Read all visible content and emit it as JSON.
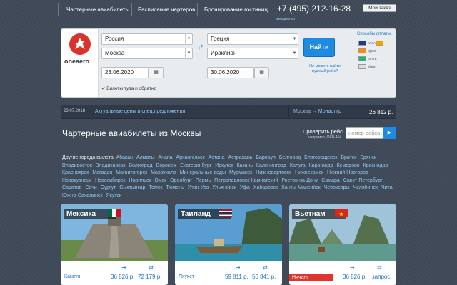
{
  "nav": {
    "links": [
      "Чартерные авиабилеты",
      "Расписание чартеров",
      "Бронирование гостиниц"
    ],
    "phone": "+7 (495) 212-16-28",
    "phone_sub": "менеджеры",
    "my_order": "Мой заказ"
  },
  "search": {
    "logo": "oneaero",
    "from_country": "Россия",
    "from_city": "Москва",
    "to_country": "Греция",
    "to_city": "Ираклион",
    "date_from": "23.06.2020",
    "date_to": "30.06.2020",
    "roundtrip_label": "Билеты туда и обратно",
    "find_button": "Найти",
    "not_found_link": "Не можете найти нужный рейс?",
    "payment_head": "Способы оплаты",
    "payment_methods": [
      "VISA",
      "MasterCard",
      "QIWI",
      "SAVE",
      "банк"
    ],
    "calendar_icon": "calendar-icon",
    "swap_icon": "swap-arrows-icon"
  },
  "infobar": {
    "date": "23.07.2018",
    "news": "Актуальные цены и спец.предложения",
    "route": "Москва → Монастир",
    "price": "26 812 р."
  },
  "main": {
    "heading": "Чартерные авиабилеты из Москвы",
    "check_label": "Проверить рейс",
    "check_sub": "например, OEB-454",
    "check_placeholder": "номер рейса",
    "check_button": "▶"
  },
  "cities": {
    "label": "Другие города вылета:",
    "list": [
      "Абакан",
      "Алматы",
      "Анапа",
      "Архангельск",
      "Астана",
      "Астрахань",
      "Барнаул",
      "Белгород",
      "Благовещенск",
      "Братск",
      "Брянск",
      "Владивосток",
      "Владикавказ",
      "Волгоград",
      "Воронеж",
      "Екатеринбург",
      "Иркутск",
      "Казань",
      "Калининград",
      "Калуга",
      "Караганда",
      "Кемерово",
      "Краснодар",
      "Красноярск",
      "Магадан",
      "Магнитогорск",
      "Махачкала",
      "Минеральные воды",
      "Мурманск",
      "Нижневартовск",
      "Нижнекамск",
      "Нижний Новгород",
      "Новокузнецк",
      "Новосибирск",
      "Норильск",
      "Омск",
      "Оренбург",
      "Пермь",
      "Петропавловск-Камчатский",
      "Ростов-на-Дону",
      "Самара",
      "Санкт-Петербург",
      "Саратов",
      "Сочи",
      "Сургут",
      "Сыктывкар",
      "Томск",
      "Тюмень",
      "Улан-Удэ",
      "Ульяновск",
      "Уфа",
      "Хабаровск",
      "Ханты-Мансийск",
      "Чебоксары",
      "Челябинск",
      "Чита",
      "Южно-Сахалинск",
      "Якутск"
    ]
  },
  "cards": [
    {
      "country": "Мексика",
      "city": "Канкун",
      "price": "36 826 р.",
      "price2": "72 179 р."
    },
    {
      "country": "Таиланд",
      "city": "Пхукет",
      "price": "59 811 р.",
      "price2": "56 841 р."
    },
    {
      "country": "Вьетнам",
      "city": "Нячанг",
      "price": "36 826 р.",
      "price2": "запрос"
    }
  ]
}
